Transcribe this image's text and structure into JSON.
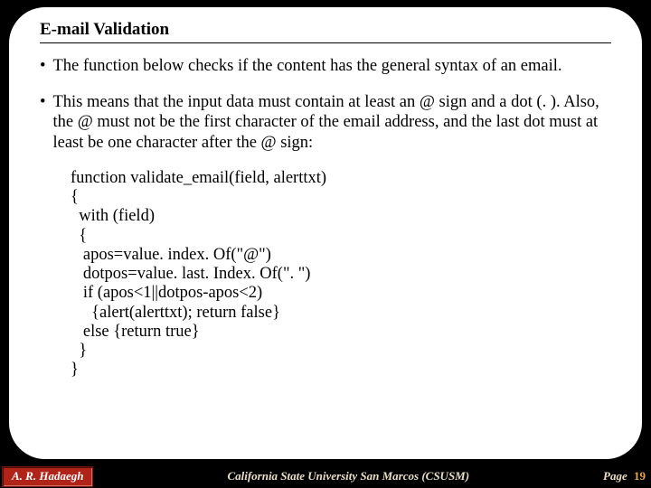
{
  "title": "E-mail Validation",
  "bullets": [
    "The function below checks if the content has the general syntax of an email.",
    "This means that the input data must contain at least an @ sign and a dot (. ). Also, the @ must not be the first character of the email address, and the last dot must at least be one character after the @ sign:"
  ],
  "code": {
    "l1": "function validate_email(field, alerttxt)",
    "l2": "{",
    "l3": "  with (field)",
    "l4": "  {",
    "l5": "   apos=value. index. Of(\"@\")",
    "l6": "   dotpos=value. last. Index. Of(\". \")",
    "l7": "   if (apos<1||dotpos-apos<2)",
    "l8": "     {alert(alerttxt); return false}",
    "l9": "   else {return true}",
    "l10": "  }",
    "l11": "}"
  },
  "footer": {
    "author": "A. R. Hadaegh",
    "university": "California State University San Marcos (CSUSM)",
    "page_label": "Page",
    "page_number": "19"
  }
}
